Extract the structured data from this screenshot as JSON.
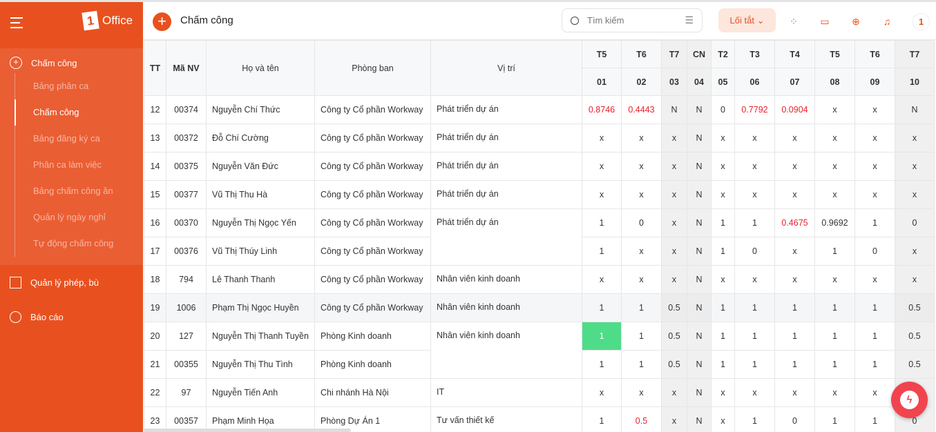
{
  "app": {
    "logo_text": "Office",
    "title": "Chấm công"
  },
  "sidebar": {
    "group": {
      "label": "Chấm công",
      "items": [
        "Bảng phân ca",
        "Chấm công",
        "Bảng đăng ký ca",
        "Phân ca làm việc",
        "Bảng chấm công ăn",
        "Quản lý ngày nghỉ",
        "Tự động chấm công"
      ],
      "active": 1
    },
    "items": [
      {
        "label": "Quản lý phép, bù",
        "icon": "list-icon"
      },
      {
        "label": "Báo cáo",
        "icon": "pie-chart-icon"
      }
    ]
  },
  "topbar": {
    "search_placeholder": "Tìm kiếm",
    "shortcut_label": "Lối tắt"
  },
  "colors": {
    "brand": "#e8511f",
    "late": "#e8212c",
    "highlight": "#4fdc88"
  },
  "table": {
    "headers": {
      "tt": "TT",
      "ma": "Mã NV",
      "ten": "Họ và tên",
      "phong": "Phòng ban",
      "vitri": "Vị trí"
    },
    "days": [
      {
        "w": "T5",
        "d": "01"
      },
      {
        "w": "T6",
        "d": "02"
      },
      {
        "w": "T7",
        "d": "03"
      },
      {
        "w": "CN",
        "d": "04"
      },
      {
        "w": "T2",
        "d": "05"
      },
      {
        "w": "T3",
        "d": "06"
      },
      {
        "w": "T4",
        "d": "07"
      },
      {
        "w": "T5",
        "d": "08"
      },
      {
        "w": "T6",
        "d": "09"
      },
      {
        "w": "T7",
        "d": "10"
      }
    ],
    "rows": [
      {
        "tt": "12",
        "ma": "00374",
        "ten": "Nguyễn Chí Thức",
        "phong": "Công ty Cổ phần Workway",
        "vitri": "Phát triển dự án",
        "cells": [
          "0.8746",
          "0.4443",
          "N",
          "N",
          "0",
          "0.7792",
          "0.0904",
          "x",
          "x",
          "N"
        ],
        "red": [
          0,
          1,
          5,
          6
        ]
      },
      {
        "tt": "13",
        "ma": "00372",
        "ten": "Đỗ Chí Cường",
        "phong": "Công ty Cổ phần Workway",
        "vitri": "Phát triển dự án",
        "cells": [
          "x",
          "x",
          "x",
          "N",
          "x",
          "x",
          "x",
          "x",
          "x",
          "x"
        ]
      },
      {
        "tt": "14",
        "ma": "00375",
        "ten": "Nguyễn Văn Đức",
        "phong": "Công ty Cổ phần Workway",
        "vitri": "Phát triển dự án",
        "cells": [
          "x",
          "x",
          "x",
          "N",
          "x",
          "x",
          "x",
          "x",
          "x",
          "x"
        ]
      },
      {
        "tt": "15",
        "ma": "00377",
        "ten": "Vũ Thị Thu Hà",
        "phong": "Công ty Cổ phần Workway",
        "vitri": "Phát triển dự án",
        "cells": [
          "x",
          "x",
          "x",
          "N",
          "x",
          "x",
          "x",
          "x",
          "x",
          "x"
        ]
      },
      {
        "tt": "16",
        "ma": "00370",
        "ten": "Nguyễn Thị Ngọc Yến",
        "phong": "Công ty Cổ phần Workway",
        "vitri": "Phát triển dự án",
        "span": 2,
        "cells": [
          "1",
          "0",
          "x",
          "N",
          "1",
          "1",
          "0.4675",
          "0.9692",
          "1",
          "0"
        ],
        "red": [
          6
        ]
      },
      {
        "tt": "17",
        "ma": "00376",
        "ten": "Vũ Thị Thúy Linh",
        "phong": "Công ty Cổ phần Workway",
        "skip": true,
        "cells": [
          "1",
          "x",
          "x",
          "N",
          "1",
          "0",
          "x",
          "1",
          "0",
          "x"
        ]
      },
      {
        "tt": "18",
        "ma": "794",
        "ten": "Lê Thanh Thanh",
        "phong": "Công ty Cổ phần Workway",
        "vitri": "Nhân viên kinh doanh",
        "cells": [
          "x",
          "x",
          "x",
          "N",
          "x",
          "x",
          "x",
          "x",
          "x",
          "x"
        ]
      },
      {
        "tt": "19",
        "ma": "1006",
        "ten": "Phạm Thị Ngọc Huyền",
        "phong": "Công ty Cổ phần Workway",
        "vitri": "Nhân viên kinh doanh",
        "hl": true,
        "cells": [
          "1",
          "1",
          "0.5",
          "N",
          "1",
          "1",
          "1",
          "1",
          "1",
          "0.5"
        ]
      },
      {
        "tt": "20",
        "ma": "127",
        "ten": "Nguyễn Thị Thanh Tuyền",
        "phong": "Phòng Kinh doanh",
        "vitri": "Nhân viên kinh doanh",
        "span": 2,
        "cells": [
          "1",
          "1",
          "0.5",
          "N",
          "1",
          "1",
          "1",
          "1",
          "1",
          "0.5"
        ],
        "green": [
          0
        ]
      },
      {
        "tt": "21",
        "ma": "00355",
        "ten": "Nguyễn Thị Thu Tình",
        "phong": "Phòng Kinh doanh",
        "skip": true,
        "cells": [
          "1",
          "1",
          "0.5",
          "N",
          "1",
          "1",
          "1",
          "1",
          "1",
          "0.5"
        ]
      },
      {
        "tt": "22",
        "ma": "97",
        "ten": "Nguyễn Tiến Anh",
        "phong": "Chi nhánh Hà Nội",
        "vitri": "IT",
        "cells": [
          "x",
          "x",
          "x",
          "N",
          "x",
          "x",
          "x",
          "x",
          "x",
          "x"
        ]
      },
      {
        "tt": "23",
        "ma": "00357",
        "ten": "Phạm Minh Họa",
        "phong": "Phòng Dự Án 1",
        "vitri": "Tư vấn thiết kế",
        "cells": [
          "1",
          "0.5",
          "x",
          "N",
          "x",
          "1",
          "0",
          "1",
          "1",
          "0"
        ],
        "red": [
          1
        ]
      }
    ]
  }
}
